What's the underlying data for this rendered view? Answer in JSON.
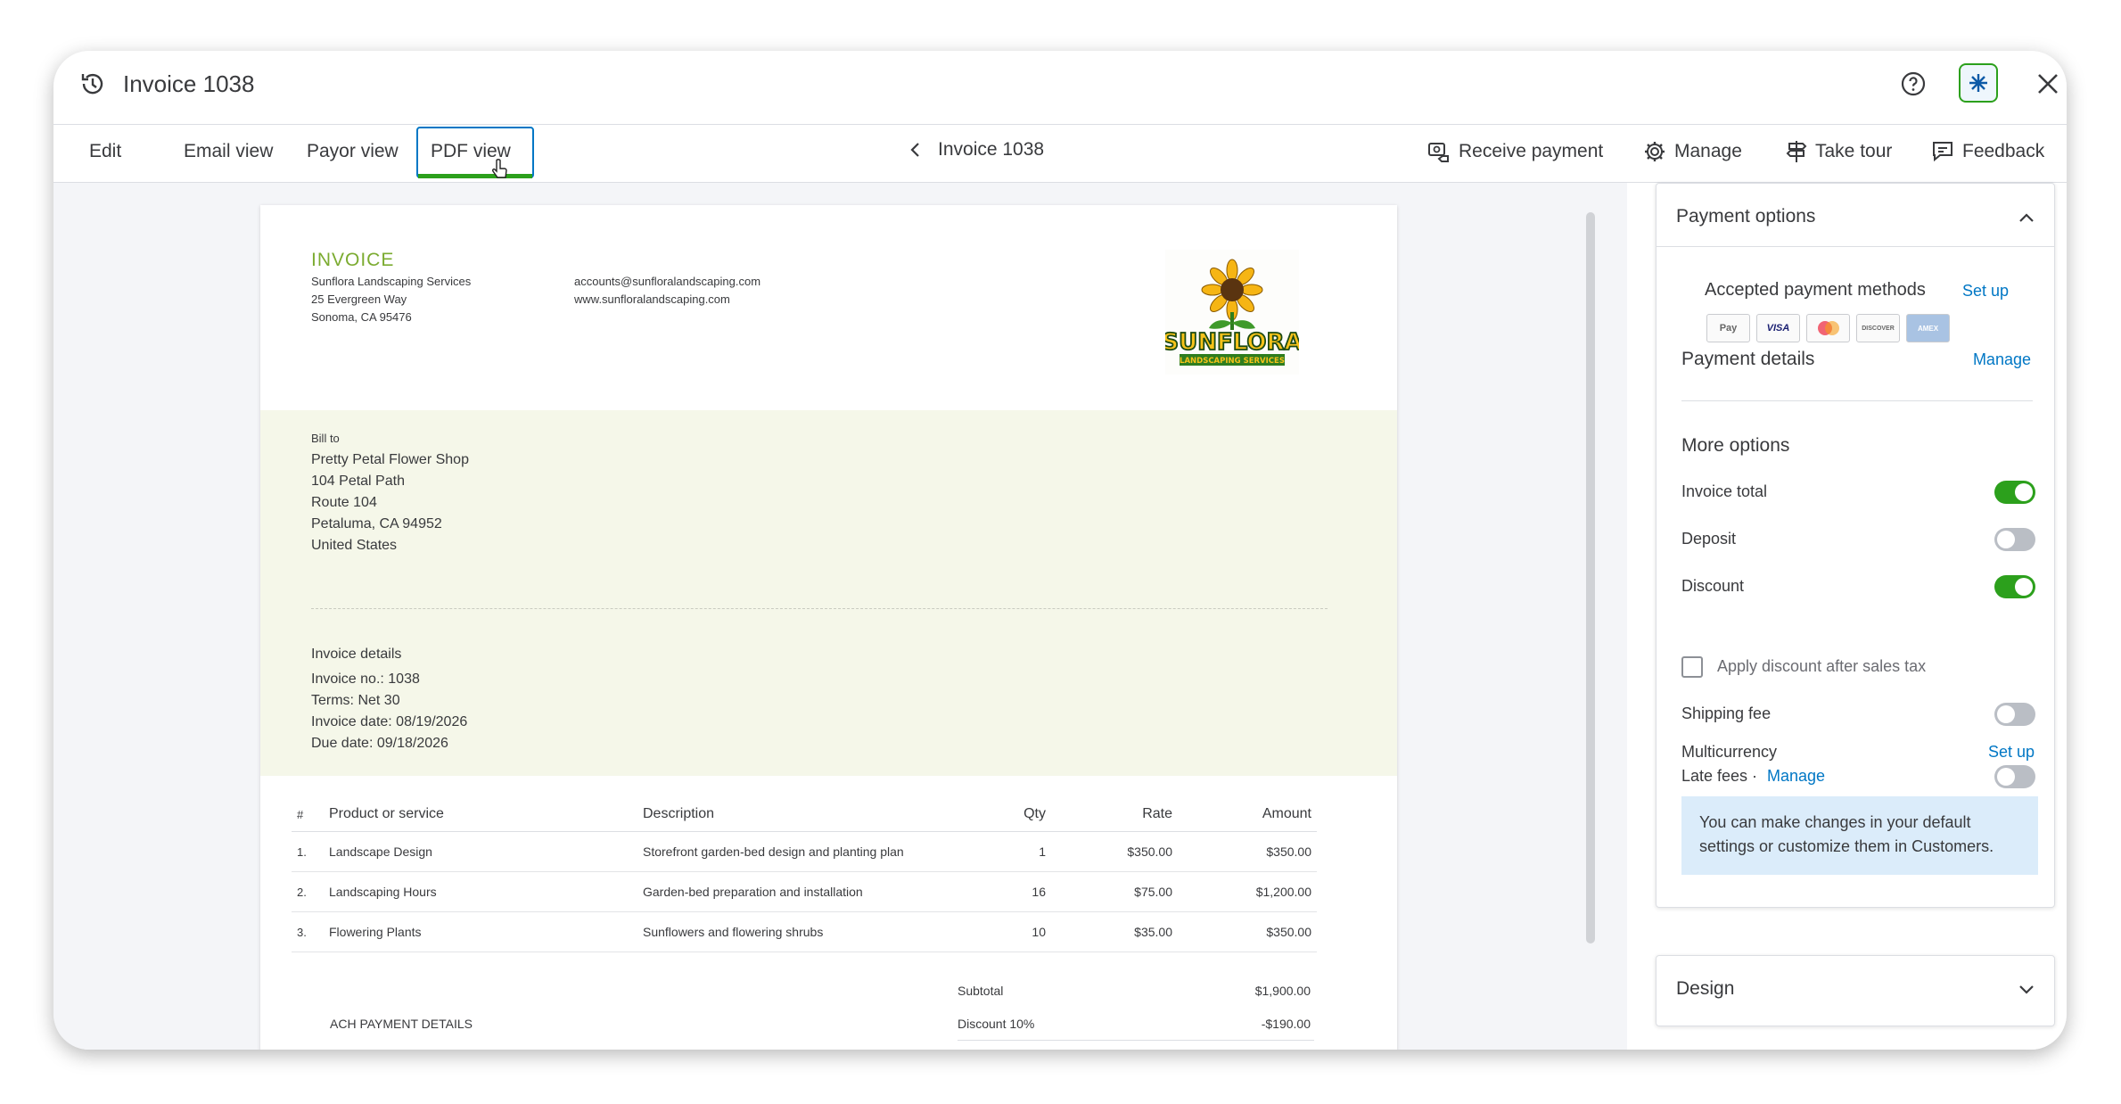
{
  "header": {
    "title": "Invoice 1038"
  },
  "toolbar": {
    "tabs": [
      "Edit",
      "Email view",
      "Payor view",
      "PDF view"
    ],
    "active_tab": "PDF view",
    "nav_title": "Invoice 1038",
    "actions": {
      "receive_payment": "Receive payment",
      "manage": "Manage",
      "take_tour": "Take tour",
      "feedback": "Feedback"
    }
  },
  "invoice": {
    "heading": "INVOICE",
    "company": {
      "name": "Sunflora Landscaping Services",
      "address1": "25 Evergreen Way",
      "address2": "Sonoma, CA 95476",
      "email": "accounts@sunfloralandscaping.com",
      "website": "www.sunfloralandscaping.com"
    },
    "logo": {
      "title": "SUNFLORA",
      "subtitle": "LANDSCAPING SERVICES"
    },
    "bill_to": {
      "label": "Bill to",
      "lines": [
        "Pretty Petal Flower Shop",
        "104 Petal Path",
        "Route 104",
        "Petaluma, CA 94952",
        "United States"
      ]
    },
    "details": {
      "label": "Invoice details",
      "invoice_no": "Invoice no.: 1038",
      "terms": "Terms: Net 30",
      "invoice_date": "Invoice date: 08/19/2026",
      "due_date": "Due date: 09/18/2026"
    },
    "columns": [
      "#",
      "Product or service",
      "Description",
      "Qty",
      "Rate",
      "Amount"
    ],
    "items": [
      {
        "num": "1.",
        "product": "Landscape Design",
        "description": "Storefront garden-bed design and planting plan",
        "qty": "1",
        "rate": "$350.00",
        "amount": "$350.00"
      },
      {
        "num": "2.",
        "product": "Landscaping Hours",
        "description": "Garden-bed preparation and installation",
        "qty": "16",
        "rate": "$75.00",
        "amount": "$1,200.00"
      },
      {
        "num": "3.",
        "product": "Flowering Plants",
        "description": "Sunflowers and flowering shrubs",
        "qty": "10",
        "rate": "$35.00",
        "amount": "$350.00"
      }
    ],
    "subtotal_label": "Subtotal",
    "subtotal_value": "$1,900.00",
    "discount_label": "Discount 10%",
    "discount_value": "-$190.00",
    "ach_label": "ACH PAYMENT DETAILS"
  },
  "panel": {
    "payment_options_title": "Payment options",
    "accepted_methods_label": "Accepted payment methods",
    "accepted_methods_link": "Set up",
    "payment_cards": [
      "Pay",
      "VISA",
      "",
      "DISCOVER",
      "AMEX"
    ],
    "payment_details_label": "Payment details",
    "payment_details_link": "Manage",
    "more_options_label": "More options",
    "options": {
      "invoice_total": {
        "label": "Invoice total",
        "on": true
      },
      "deposit": {
        "label": "Deposit",
        "on": false
      },
      "discount": {
        "label": "Discount",
        "on": true
      },
      "apply_discount_after_tax": {
        "label": "Apply discount after sales tax",
        "checked": false
      },
      "shipping_fee": {
        "label": "Shipping fee",
        "on": false
      },
      "multicurrency": {
        "label": "Multicurrency",
        "link": "Set up"
      },
      "late_fees": {
        "label": "Late fees ·",
        "link": "Manage",
        "on": false
      }
    },
    "info_text": "You can make changes in your default settings or customize them in Customers.",
    "design_title": "Design"
  },
  "colors": {
    "accent_green": "#2ca01c",
    "link_blue": "#0077c5",
    "invoice_heading": "#7bab30",
    "band": "#f5f7e9"
  }
}
